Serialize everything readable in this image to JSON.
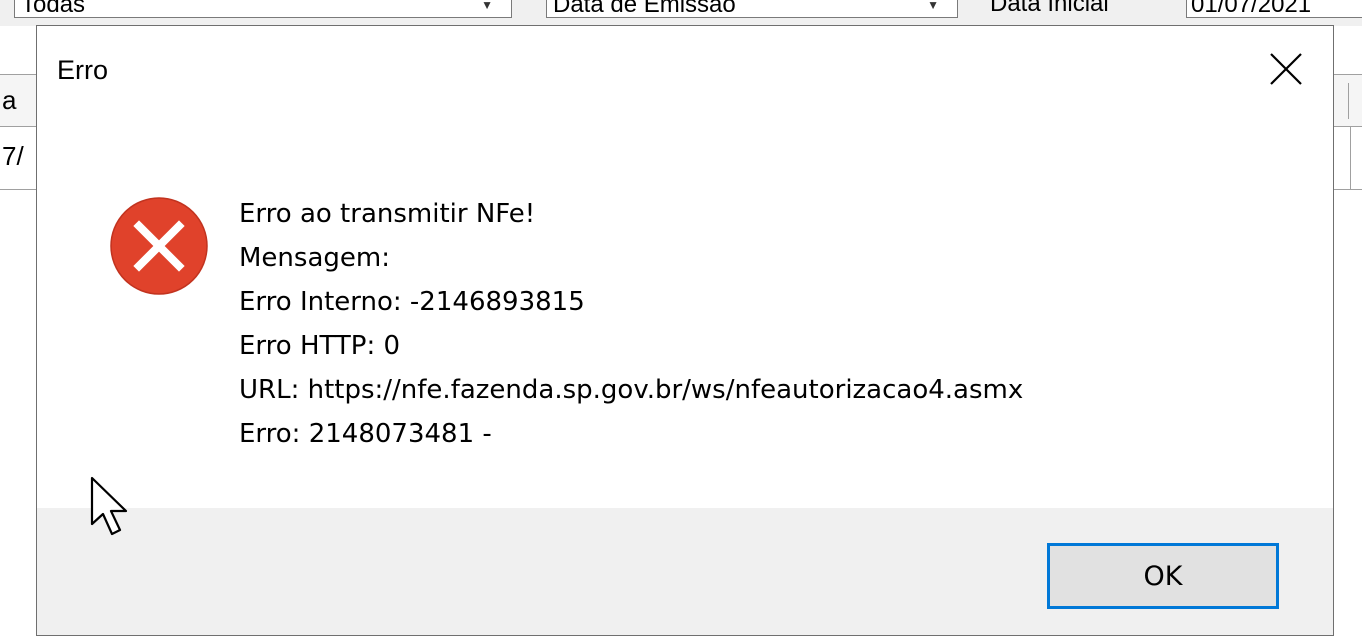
{
  "background": {
    "filter_combo": "Todas",
    "date_type_combo": "Data de Emissão",
    "start_date_label": "Data Inicial",
    "start_date_value": "01/07/2021",
    "grid_header_left": "a",
    "grid_row_left": "7/"
  },
  "dialog": {
    "title": "Erro",
    "icon": "error-icon",
    "message_lines": [
      "Erro ao transmitir NFe!",
      "Mensagem:",
      "Erro Interno: -2146893815",
      "Erro HTTP: 0",
      "URL: https://nfe.fazenda.sp.gov.br/ws/nfeautorizacao4.asmx",
      "Erro: 2148073481 -"
    ],
    "ok_label": "OK"
  },
  "colors": {
    "error_icon": "#e0422b",
    "focus_border": "#0078d7",
    "footer_bg": "#f0f0f0",
    "button_bg": "#e1e1e1"
  }
}
